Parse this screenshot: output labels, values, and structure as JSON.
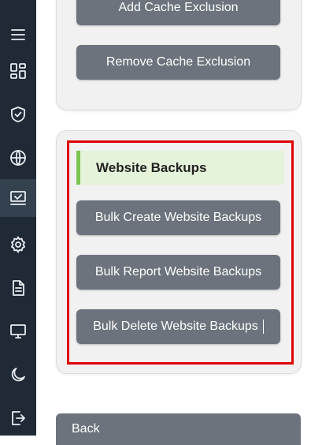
{
  "sidebar": {
    "icons": [
      "menu-icon",
      "dashboard-icon",
      "shield-check-icon",
      "globe-icon",
      "monitor-check-icon",
      "gear-icon",
      "document-icon",
      "desktop-icon",
      "moon-icon",
      "logout-icon"
    ],
    "active": "monitor-check-icon"
  },
  "cache": {
    "add_label": "Add Cache Exclusion",
    "remove_label": "Remove Cache Exclusion"
  },
  "backups": {
    "title": "Website Backups",
    "create_label": "Bulk Create Website Backups",
    "report_label": "Bulk Report Website Backups",
    "delete_label": "Bulk Delete Website Backups"
  },
  "back_label": "Back",
  "colors": {
    "sidebar_bg": "#1f2a36",
    "button_bg": "#6c737c",
    "section_header_bg": "#e4f3da",
    "section_accent": "#7cc552",
    "highlight_border": "#e00000"
  }
}
